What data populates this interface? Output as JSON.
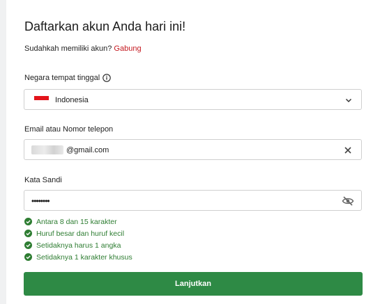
{
  "form": {
    "title": "Daftarkan akun Anda hari ini!",
    "subtitle_prefix": "Sudahkah memiliki akun?",
    "subtitle_link": "Gabung",
    "country_label": "Negara tempat tinggal",
    "country_value": "Indonesia",
    "email_label": "Email atau Nomor telepon",
    "email_value": "@gmail.com",
    "password_label": "Kata Sandi",
    "password_value": "••••••••",
    "rules": [
      "Antara 8 dan 15 karakter",
      "Huruf besar dan huruf kecil",
      "Setidaknya harus 1 angka",
      "Setidaknya 1 karakter khusus"
    ],
    "submit_label": "Lanjutkan"
  },
  "colors": {
    "link": "#c4181f",
    "success": "#2e7d32",
    "button": "#2e8a45",
    "flag_red": "#e3141b"
  },
  "icons": {
    "info": "info-icon",
    "chevron": "chevron-down-icon",
    "clear": "close-icon",
    "visibility": "eye-off-icon",
    "check": "check-circle-icon"
  }
}
